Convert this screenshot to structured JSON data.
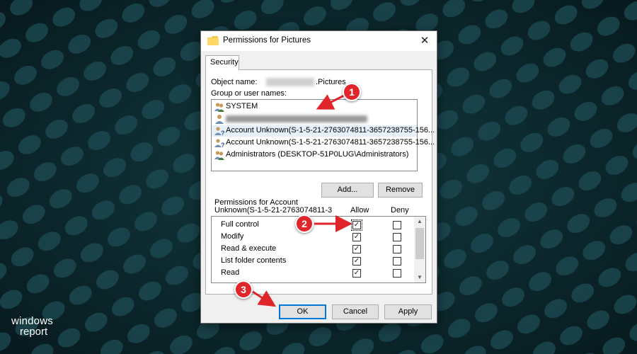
{
  "dialog": {
    "title": "Permissions for Pictures",
    "close_glyph": "✕",
    "tab_security": "Security",
    "object_name_label": "Object name:",
    "object_name_value": ".Pictures",
    "group_label": "Group or user names:",
    "users": [
      {
        "label": "SYSTEM",
        "icon": "users-group-icon"
      },
      {
        "label": "",
        "icon": "user-icon",
        "blurred": true
      },
      {
        "label": "Account Unknown(S-1-5-21-2763074811-3657238755-156...",
        "icon": "unknown-account-icon"
      },
      {
        "label": "Account Unknown(S-1-5-21-2763074811-3657238755-156...",
        "icon": "unknown-account-icon"
      },
      {
        "label": "Administrators (DESKTOP-51P0LUG\\Administrators)",
        "icon": "users-group-icon"
      }
    ],
    "add_button": "Add...",
    "remove_button": "Remove",
    "permissions_for_line1": "Permissions for Account",
    "permissions_for_line2": "Unknown(S-1-5-21-2763074811-3",
    "allow_header": "Allow",
    "deny_header": "Deny",
    "permissions": [
      {
        "name": "Full control",
        "allow": true,
        "deny": false
      },
      {
        "name": "Modify",
        "allow": true,
        "deny": false
      },
      {
        "name": "Read & execute",
        "allow": true,
        "deny": false
      },
      {
        "name": "List folder contents",
        "allow": true,
        "deny": false
      },
      {
        "name": "Read",
        "allow": true,
        "deny": false
      }
    ],
    "ok_button": "OK",
    "cancel_button": "Cancel",
    "apply_button": "Apply"
  },
  "annotations": [
    "1",
    "2",
    "3"
  ],
  "branding": {
    "line1": "windows",
    "line2": "report"
  },
  "colors": {
    "annotation": "#e0262b",
    "background": "#0c2a30",
    "focus": "#0078d7"
  }
}
